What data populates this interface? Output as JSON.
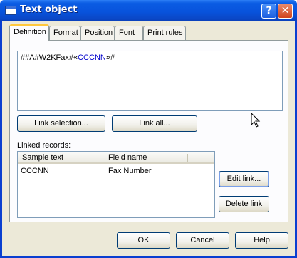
{
  "window": {
    "title": "Text object",
    "help_label": "?",
    "close_label": "✕"
  },
  "tabs": [
    {
      "label": "Definition",
      "active": true
    },
    {
      "label": "Format",
      "active": false
    },
    {
      "label": "Position",
      "active": false
    },
    {
      "label": "Font",
      "active": false
    },
    {
      "label": "Print rules",
      "active": false
    }
  ],
  "definition": {
    "text_prefix": "##A#W2KFax#«",
    "text_link": "CCCNN",
    "text_suffix": "»#",
    "link_selection_label": "Link selection...",
    "link_all_label": "Link all...",
    "linked_records_label": "Linked records:",
    "columns": [
      "Sample text",
      "Field name"
    ],
    "rows": [
      {
        "sample_text": "CCCNN",
        "field_name": "Fax Number"
      }
    ],
    "edit_link_label": "Edit link...",
    "delete_link_label": "Delete link"
  },
  "footer": {
    "ok_label": "OK",
    "cancel_label": "Cancel",
    "help_label": "Help"
  }
}
